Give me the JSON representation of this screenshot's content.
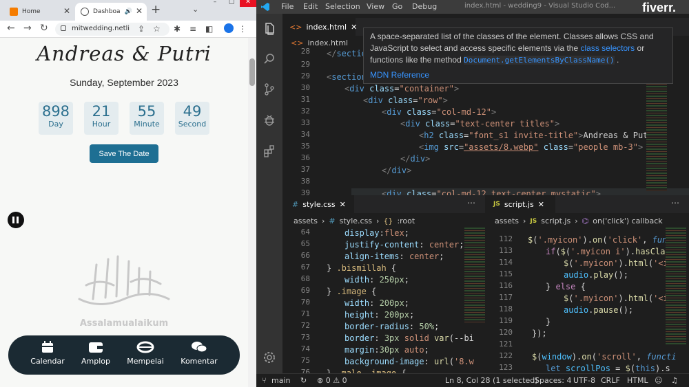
{
  "browser": {
    "tabs": [
      {
        "label": "Home"
      },
      {
        "label": "Dashboa"
      }
    ],
    "new_tab": "+",
    "url": "mitwedding.netli"
  },
  "page": {
    "couple": "Andreas & Putri",
    "date": "Sunday, September 2023",
    "countdown": [
      {
        "value": "898",
        "label": "Day"
      },
      {
        "value": "21",
        "label": "Hour"
      },
      {
        "value": "55",
        "label": "Minute"
      },
      {
        "value": "49",
        "label": "Second"
      }
    ],
    "save_button": "Save The Date",
    "salam": "Assalamualaikum",
    "nav": [
      {
        "label": "Calendar",
        "icon": "calendar-icon"
      },
      {
        "label": "Amplop",
        "icon": "wallet-icon"
      },
      {
        "label": "Mempelai",
        "icon": "rings-icon"
      },
      {
        "label": "Komentar",
        "icon": "chat-icon"
      }
    ]
  },
  "vscode": {
    "menu": [
      "File",
      "Edit",
      "Selection",
      "View",
      "Go",
      "Debug"
    ],
    "window_title": "index.html - wedding9 - Visual Studio Cod...",
    "brand": "fiverr.",
    "top_tab": "index.html",
    "top_breadcrumb": "index.html",
    "hover": {
      "text1": "A space-separated list of the classes of the element. Classes allows CSS and JavaScript to select and access specific elements via the ",
      "link": "class selectors",
      "text2": " or functions like the method ",
      "code": "Document.getElementsByClassName()",
      "text3": " .",
      "mdn": "MDN Reference"
    },
    "css_tab": "style.css",
    "css_breadcrumb": [
      "assets",
      "style.css",
      ":root"
    ],
    "js_tab": "script.js",
    "js_breadcrumb": [
      "assets",
      "script.js",
      "on('click') callback"
    ],
    "status": {
      "branch": "main",
      "problems": "⊗ 0 ⚠ 0",
      "position": "Ln 8, Col 28 (1 selected)",
      "spaces": "Spaces: 4",
      "encoding": "UTF-8",
      "eol": "CRLF",
      "language": "HTML"
    }
  }
}
